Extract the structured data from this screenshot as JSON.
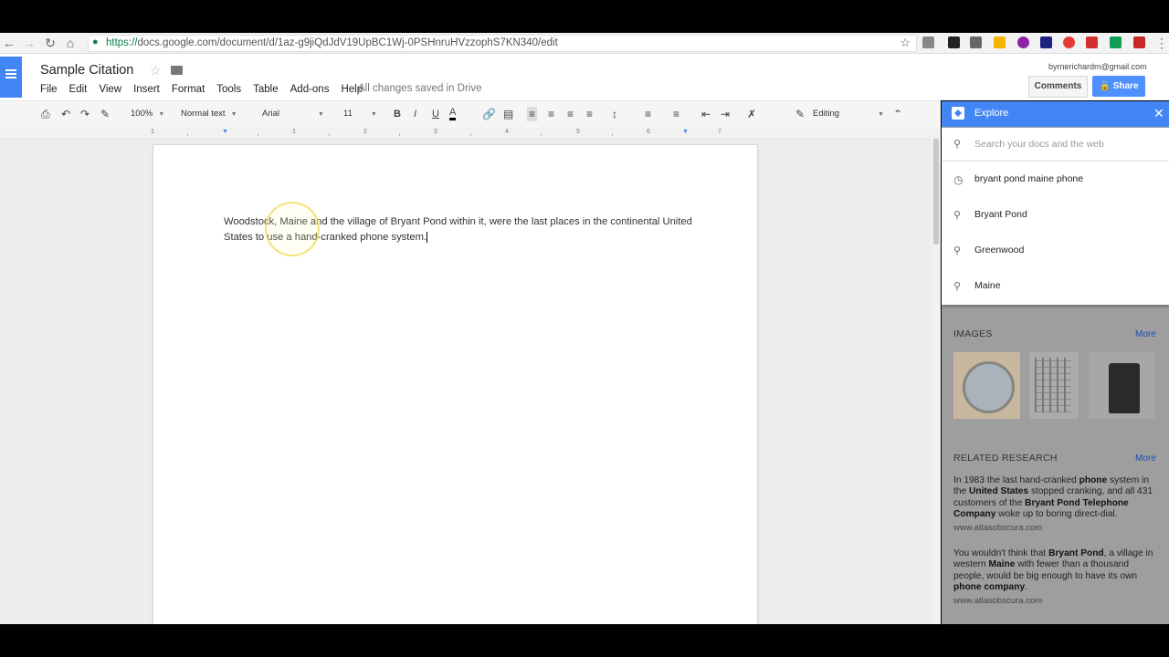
{
  "browser": {
    "url_proto": "https://",
    "url_rest": "docs.google.com/document/d/1az-g9jiQdJdV19UpBC1Wj-0PSHnruHVzzophS7KN340/edit"
  },
  "doc": {
    "title": "Sample Citation",
    "menu": [
      "File",
      "Edit",
      "View",
      "Insert",
      "Format",
      "Tools",
      "Table",
      "Add-ons",
      "Help"
    ],
    "save_status": "All changes saved in Drive",
    "user_email": "byrnerichardm@gmail.com",
    "comments_label": "Comments",
    "share_label": "Share",
    "body_text": "Woodstock, Maine and the village of Bryant Pond within it, were the last places in the continental United States to use a hand-cranked phone system."
  },
  "toolbar": {
    "zoom": "100%",
    "style": "Normal text",
    "font": "Arial",
    "size": "11",
    "bold": "B",
    "italic": "I",
    "underline": "U",
    "text_color": "A",
    "mode": "Editing"
  },
  "ruler": {
    "labels": [
      "1",
      "1",
      "2",
      "3",
      "4",
      "5",
      "6",
      "7"
    ]
  },
  "explore": {
    "title": "Explore",
    "search_placeholder": "Search your docs and the web",
    "suggestions": [
      "bryant pond maine phone",
      "Bryant Pond",
      "Greenwood",
      "Maine"
    ],
    "images_heading": "IMAGES",
    "images_more": "More",
    "research_heading": "RELATED RESEARCH",
    "research_more": "More",
    "results": [
      {
        "source": "www.atlasobscura.com"
      },
      {
        "source": "www.atlasobscura.com"
      }
    ]
  },
  "colors": {
    "accent_blue": "#4285f4",
    "share_blue": "#4d90fe",
    "link_blue": "#1a4fb0"
  }
}
